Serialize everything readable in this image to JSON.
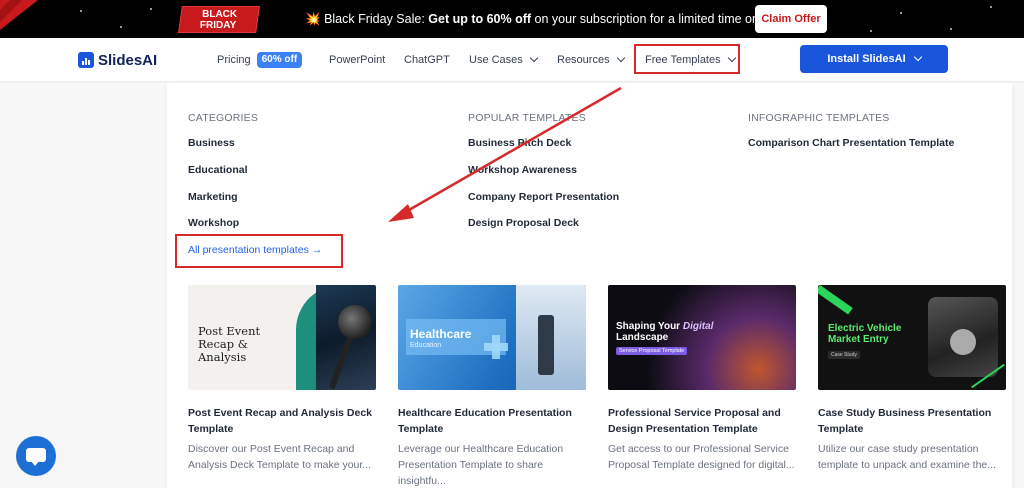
{
  "promo": {
    "badge_line1": "BLACK",
    "badge_line2": "FRIDAY",
    "sale_label": "Black Friday Sale:",
    "sale_highlight": "Get up to 60% off",
    "sale_rest": "on your subscription for a limited time only",
    "claim_label": "Claim Offer",
    "emoji_left": "💥",
    "emoji_right": "🛍️"
  },
  "nav": {
    "logo_text": "SlidesAI",
    "pricing": "Pricing",
    "pricing_badge": "60% off",
    "powerpoint": "PowerPoint",
    "chatgpt": "ChatGPT",
    "use_cases": "Use Cases",
    "resources": "Resources",
    "free_templates": "Free Templates",
    "install": "Install SlidesAI"
  },
  "menu": {
    "categories": {
      "heading": "CATEGORIES",
      "items": [
        "Business",
        "Educational",
        "Marketing",
        "Workshop"
      ],
      "all_link": "All presentation templates →"
    },
    "popular": {
      "heading": "POPULAR TEMPLATES",
      "items": [
        "Business Pitch Deck",
        "Workshop Awareness",
        "Company Report Presentation",
        "Design Proposal Deck"
      ]
    },
    "infographic": {
      "heading": "INFOGRAPHIC TEMPLATES",
      "items": [
        "Comparison Chart Presentation Template"
      ]
    }
  },
  "cards": [
    {
      "thumb_text": "Post Event Recap & Analysis",
      "title": "Post Event Recap and Analysis Deck Template",
      "desc_line1": "Discover our Post Event Recap and",
      "desc_line2": "Analysis Deck Template to make your..."
    },
    {
      "thumb_title": "Healthcare",
      "thumb_sub": "Education",
      "title": "Healthcare Education Presentation Template",
      "desc_line1": "Leverage our Healthcare Education",
      "desc_line2": "Presentation Template to share insightfu..."
    },
    {
      "thumb_title_a": "Shaping Your",
      "thumb_title_b": "Digital",
      "thumb_title_c": "Landscape",
      "thumb_tag": "Service Proposal Template",
      "title": "Professional Service Proposal and Design Presentation Template",
      "desc_line1": "Get access to our Professional Service",
      "desc_line2": "Proposal Template designed for digital..."
    },
    {
      "thumb_title_a": "Electric Vehicle",
      "thumb_title_b": "Market Entry",
      "thumb_tag": "Case Study",
      "title": "Case Study Business Presentation Template",
      "desc_line1": "Utilize our case study presentation",
      "desc_line2": "template to unpack and examine the..."
    }
  ],
  "colors": {
    "accent": "#1a56db",
    "annotation": "#d62a2a",
    "promo_bg": "#000000"
  }
}
